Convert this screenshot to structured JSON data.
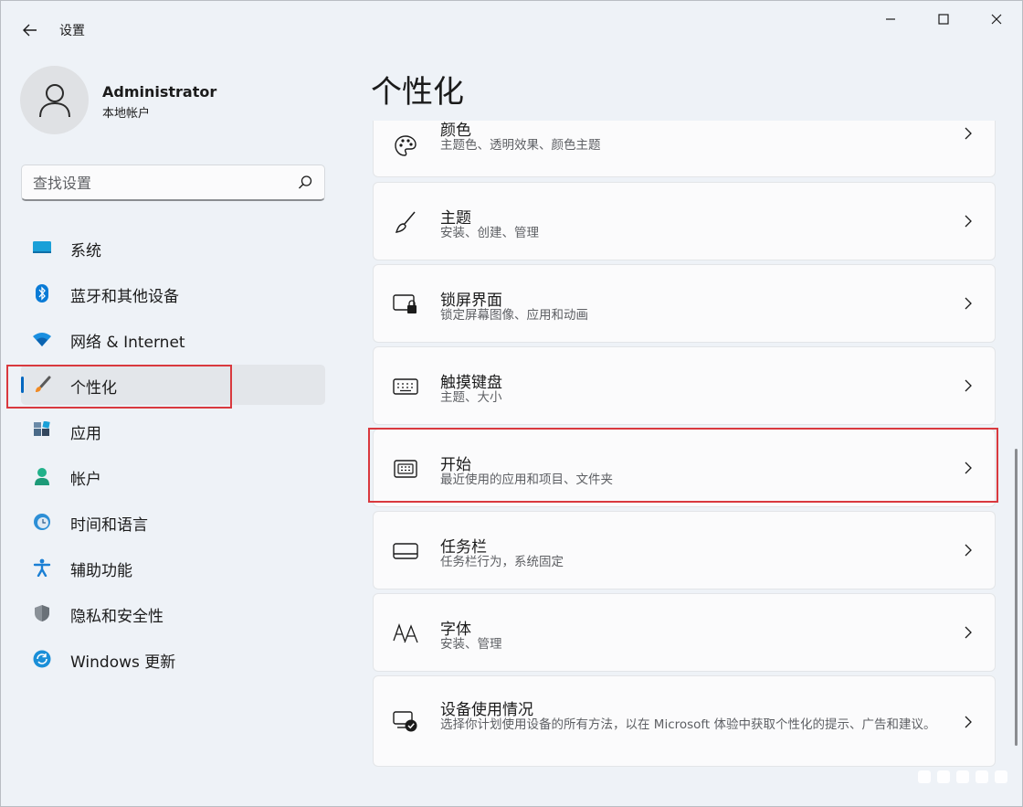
{
  "window": {
    "title": "设置"
  },
  "user": {
    "name": "Administrator",
    "account_type": "本地帐户"
  },
  "search": {
    "placeholder": "查找设置"
  },
  "sidebar": {
    "items": [
      {
        "label": "系统",
        "icon": "system-display-icon"
      },
      {
        "label": "蓝牙和其他设备",
        "icon": "bluetooth-icon"
      },
      {
        "label": "网络 & Internet",
        "icon": "wifi-icon"
      },
      {
        "label": "个性化",
        "icon": "paintbrush-icon",
        "active": true
      },
      {
        "label": "应用",
        "icon": "apps-icon"
      },
      {
        "label": "帐户",
        "icon": "account-icon"
      },
      {
        "label": "时间和语言",
        "icon": "time-language-icon"
      },
      {
        "label": "辅助功能",
        "icon": "accessibility-icon"
      },
      {
        "label": "隐私和安全性",
        "icon": "shield-icon"
      },
      {
        "label": "Windows 更新",
        "icon": "update-icon"
      }
    ]
  },
  "main": {
    "title": "个性化",
    "cards": [
      {
        "title": "颜色",
        "subtitle": "主题色、透明效果、颜色主题",
        "icon": "palette-icon"
      },
      {
        "title": "主题",
        "subtitle": "安装、创建、管理",
        "icon": "brush-icon"
      },
      {
        "title": "锁屏界面",
        "subtitle": "锁定屏幕图像、应用和动画",
        "icon": "lock-screen-icon"
      },
      {
        "title": "触摸键盘",
        "subtitle": "主题、大小",
        "icon": "keyboard-icon"
      },
      {
        "title": "开始",
        "subtitle": "最近使用的应用和项目、文件夹",
        "icon": "start-icon"
      },
      {
        "title": "任务栏",
        "subtitle": "任务栏行为，系统固定",
        "icon": "taskbar-icon"
      },
      {
        "title": "字体",
        "subtitle": "安装、管理",
        "icon": "fonts-icon"
      },
      {
        "title": "设备使用情况",
        "subtitle": "选择你计划使用设备的所有方法，以在 Microsoft 体验中获取个性化的提示、广告和建议。",
        "icon": "device-usage-icon"
      }
    ]
  },
  "colors": {
    "accent": "#0067c0",
    "highlight": "#d9393e"
  }
}
